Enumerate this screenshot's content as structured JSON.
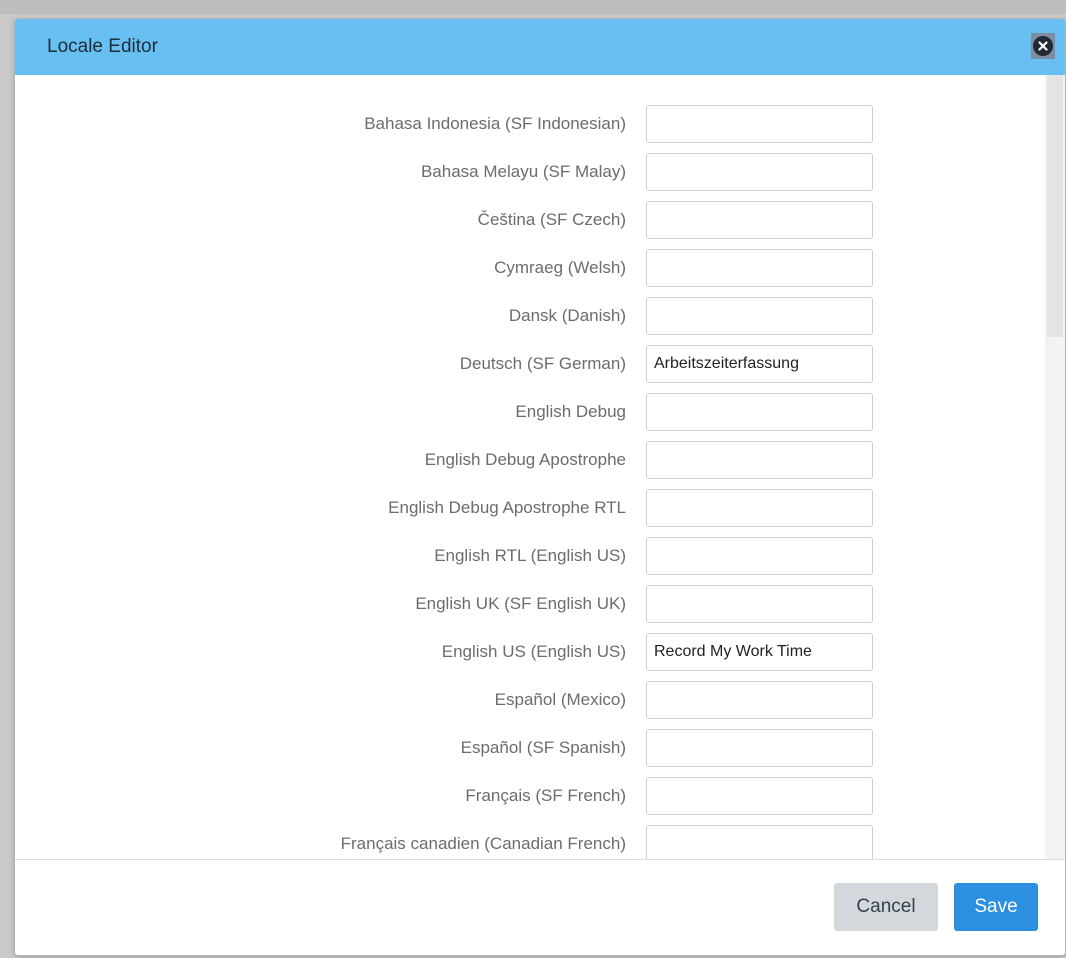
{
  "dialog": {
    "title": "Locale Editor"
  },
  "locales": [
    {
      "label": "Bahasa Indonesia (SF Indonesian)",
      "value": ""
    },
    {
      "label": "Bahasa Melayu (SF Malay)",
      "value": ""
    },
    {
      "label": "Čeština (SF Czech)",
      "value": ""
    },
    {
      "label": "Cymraeg (Welsh)",
      "value": ""
    },
    {
      "label": "Dansk (Danish)",
      "value": ""
    },
    {
      "label": "Deutsch (SF German)",
      "value": "Arbeitszeiterfassung"
    },
    {
      "label": "English Debug",
      "value": ""
    },
    {
      "label": "English Debug Apostrophe",
      "value": ""
    },
    {
      "label": "English Debug Apostrophe RTL",
      "value": ""
    },
    {
      "label": "English RTL (English US)",
      "value": ""
    },
    {
      "label": "English UK (SF English UK)",
      "value": ""
    },
    {
      "label": "English US (English US)",
      "value": "Record My Work Time"
    },
    {
      "label": "Español (Mexico)",
      "value": ""
    },
    {
      "label": "Español (SF Spanish)",
      "value": ""
    },
    {
      "label": "Français (SF French)",
      "value": ""
    },
    {
      "label": "Français canadien (Canadian French)",
      "value": ""
    }
  ],
  "footer": {
    "cancel_label": "Cancel",
    "save_label": "Save"
  },
  "icons": {
    "close": "close-icon"
  },
  "colors": {
    "header": "#68bff1",
    "primary": "#2c8fe0",
    "secondary": "#d3d8dd"
  }
}
